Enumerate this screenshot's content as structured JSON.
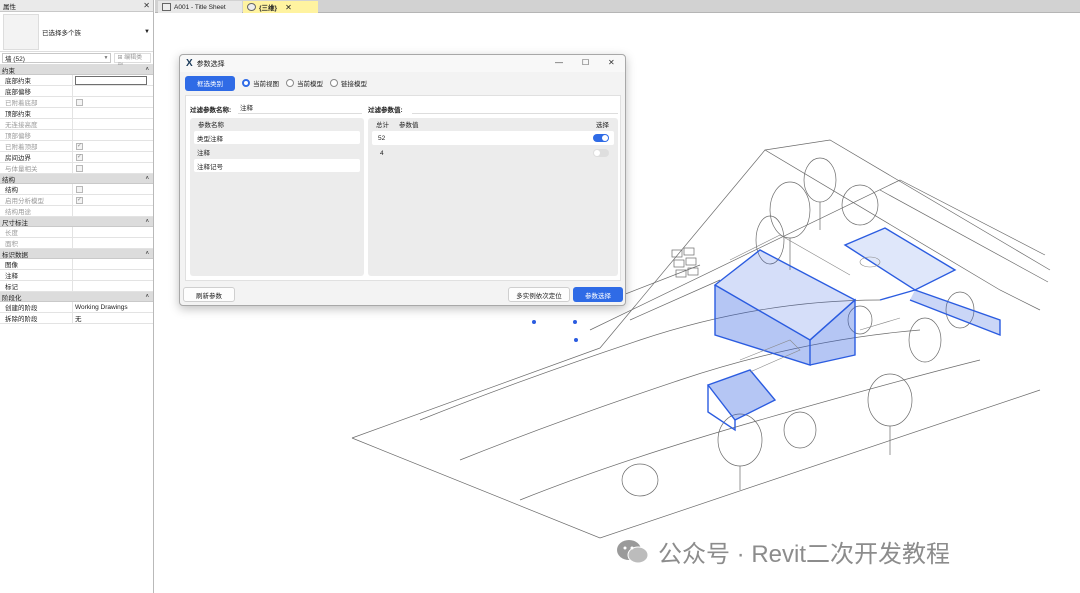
{
  "properties": {
    "title": "属性",
    "type_name": "已选择多个族",
    "filter_value": "墙 (52)",
    "edit_type_label": "编辑类型",
    "sections": [
      {
        "name": "约束",
        "rows": [
          {
            "key": "底部约束",
            "value": "",
            "kind": "edit",
            "dim": false
          },
          {
            "key": "底部偏移",
            "value": "",
            "kind": "text",
            "dim": false
          },
          {
            "key": "已附着底部",
            "value": "",
            "kind": "cb",
            "dim": true
          },
          {
            "key": "顶部约束",
            "value": "",
            "kind": "text",
            "dim": false
          },
          {
            "key": "无连接高度",
            "value": "",
            "kind": "text",
            "dim": true
          },
          {
            "key": "顶部偏移",
            "value": "",
            "kind": "text",
            "dim": true
          },
          {
            "key": "已附着顶部",
            "value": "",
            "kind": "cbon",
            "dim": true
          },
          {
            "key": "房间边界",
            "value": "",
            "kind": "cbon",
            "dim": false
          },
          {
            "key": "与体量相关",
            "value": "",
            "kind": "cb",
            "dim": true
          }
        ]
      },
      {
        "name": "结构",
        "rows": [
          {
            "key": "结构",
            "value": "",
            "kind": "cb",
            "dim": false
          },
          {
            "key": "启用分析模型",
            "value": "",
            "kind": "cbon",
            "dim": true
          },
          {
            "key": "结构用途",
            "value": "",
            "kind": "text",
            "dim": true
          }
        ]
      },
      {
        "name": "尺寸标注",
        "rows": [
          {
            "key": "长度",
            "value": "",
            "kind": "text",
            "dim": true
          },
          {
            "key": "面积",
            "value": "",
            "kind": "text",
            "dim": true
          }
        ]
      },
      {
        "name": "标识数据",
        "rows": [
          {
            "key": "图像",
            "value": "",
            "kind": "text",
            "dim": false
          },
          {
            "key": "注释",
            "value": "",
            "kind": "text",
            "dim": false
          },
          {
            "key": "标记",
            "value": "",
            "kind": "text",
            "dim": false
          }
        ]
      },
      {
        "name": "阶段化",
        "rows": [
          {
            "key": "创建的阶段",
            "value": "Working Drawings",
            "kind": "text",
            "dim": false
          },
          {
            "key": "拆除的阶段",
            "value": "无",
            "kind": "text",
            "dim": false
          }
        ]
      }
    ]
  },
  "tabs": [
    {
      "label": "A001 - Title Sheet",
      "active": false
    },
    {
      "label": "{三维}",
      "active": true
    }
  ],
  "dialog": {
    "title": "参数选择",
    "frame_select_button": "框选类别",
    "scope_options": [
      {
        "label": "当前视图",
        "selected": true
      },
      {
        "label": "当前模型",
        "selected": false
      },
      {
        "label": "链接模型",
        "selected": false
      }
    ],
    "filter_name_label": "过滤参数名称:",
    "filter_name_value": "注释",
    "filter_value_label": "过滤参数值:",
    "param_list_header": "参数名称",
    "params": [
      "类型注释",
      "注释",
      "注释记号"
    ],
    "value_headers": {
      "total": "总计",
      "value": "参数值",
      "select": "选择"
    },
    "values": [
      {
        "total": "52",
        "value": "",
        "selected": true
      },
      {
        "total": "4",
        "value": "",
        "selected": false
      }
    ],
    "refresh_button": "刷新参数",
    "locate_button": "多实例依次定位",
    "confirm_button": "参数选择"
  },
  "watermark": "公众号 · Revit二次开发教程",
  "colors": {
    "accent": "#2f6be6",
    "selection": "#2b5ce0"
  }
}
